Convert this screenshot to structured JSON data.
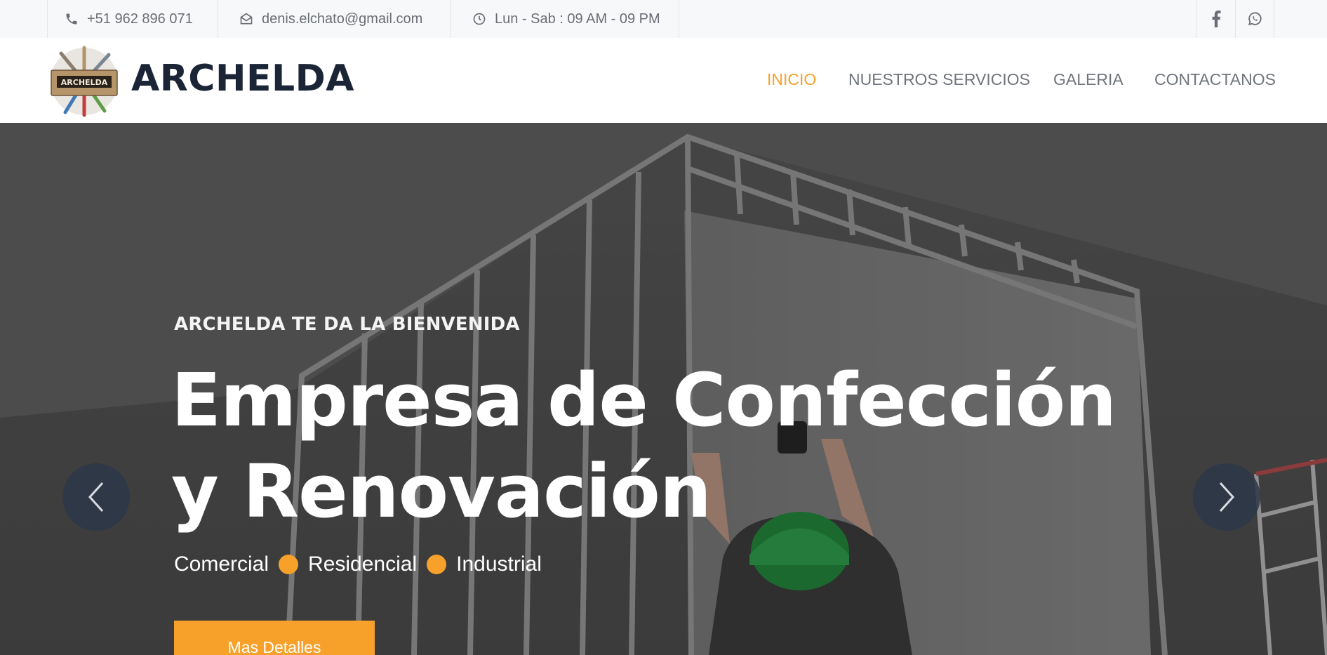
{
  "topbar": {
    "phone": "+51 962 896 071",
    "email": "denis.elchato@gmail.com",
    "hours": "Lun - Sab : 09 AM - 09 PM",
    "social": [
      {
        "icon": "facebook-icon"
      },
      {
        "icon": "whatsapp-icon"
      }
    ]
  },
  "header": {
    "logo_text": "ARCHELDA",
    "brand": "ARCHELDA",
    "nav": [
      {
        "label": "INICIO",
        "active": true
      },
      {
        "label": "NUESTROS SERVICIOS",
        "active": false
      },
      {
        "label": "GALERIA",
        "active": false
      },
      {
        "label": "CONTACTANOS",
        "active": false
      }
    ]
  },
  "hero": {
    "eyebrow": "ARCHELDA TE DA LA BIENVENIDA",
    "headline_line1": "Empresa de Confección",
    "headline_line2": "y Renovación",
    "tags": [
      "Comercial",
      "Residencial",
      "Industrial"
    ],
    "cta_label": "Mas Detalles"
  },
  "colors": {
    "accent": "#f7a12b",
    "brand_dark": "#1b2536",
    "nav_gray": "#6f747b",
    "topbar_bg": "#f7f8fa",
    "arrow_bg": "#2d3748"
  }
}
